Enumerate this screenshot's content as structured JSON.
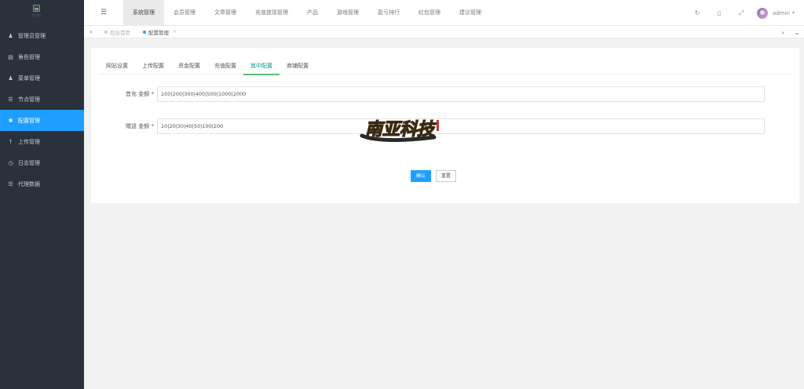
{
  "logo": {
    "alt": "logo"
  },
  "sidebar": {
    "items": [
      {
        "label": "管理员管理",
        "icon": "user-icon"
      },
      {
        "label": "角色管理",
        "icon": "id-card-icon"
      },
      {
        "label": "菜单管理",
        "icon": "user-icon"
      },
      {
        "label": "节点管理",
        "icon": "list-icon"
      },
      {
        "label": "配置管理",
        "icon": "gear-icon"
      },
      {
        "label": "上传管理",
        "icon": "upload-icon"
      },
      {
        "label": "日志管理",
        "icon": "clock-icon"
      },
      {
        "label": "代理数据",
        "icon": "list-icon"
      }
    ],
    "active_index": 4
  },
  "header": {
    "nav": [
      "系统管理",
      "会员管理",
      "文章管理",
      "充值提现管理",
      "产品",
      "游戏管理",
      "盈亏排行",
      "红包管理",
      "建议管理"
    ],
    "active_index": 0,
    "user_name": "admin"
  },
  "tabbar": {
    "tabs": [
      {
        "label": "控台首页"
      },
      {
        "label": "配置管理"
      }
    ],
    "active_index": 1
  },
  "config": {
    "subtabs": [
      "网站设置",
      "上传配置",
      "资金配置",
      "充值配置",
      "其中配置",
      "商铺配置"
    ],
    "active_index": 4,
    "fields": [
      {
        "label": "首充 金额 *",
        "value": "100|200|300|400|500|1000|2000"
      },
      {
        "label": "赠送 金额 *",
        "value": "10|20|30|40|50|100|200"
      }
    ],
    "confirm_label": "确认",
    "reset_label": "重置"
  },
  "watermark": {
    "text": "南亚科技"
  },
  "colors": {
    "sidebar_bg": "#2b313c",
    "accent": "#1e9fff",
    "tab_active": "#009688"
  }
}
